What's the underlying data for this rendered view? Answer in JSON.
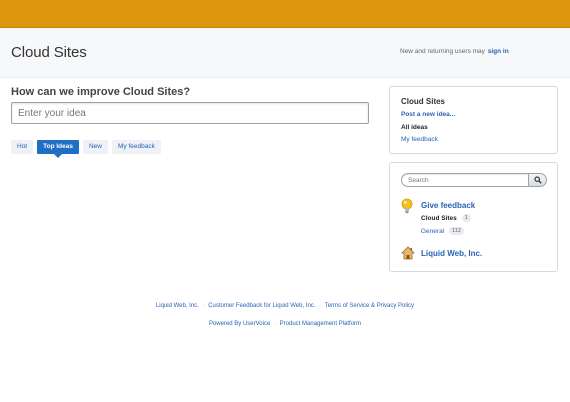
{
  "header": {
    "site_title": "Cloud Sites",
    "signin_prefix": "New and returning users may",
    "signin_link": "sign in"
  },
  "main": {
    "prompt": "How can we improve Cloud Sites?",
    "idea_placeholder": "Enter your idea",
    "tabs": [
      {
        "label": "Hot",
        "active": false
      },
      {
        "label": "Top Ideas",
        "active": true
      },
      {
        "label": "New",
        "active": false
      },
      {
        "label": "My feedback",
        "active": false
      }
    ]
  },
  "sidebar": {
    "forum_title": "Cloud Sites",
    "post_idea": "Post a new idea...",
    "all_ideas": "All ideas",
    "my_feedback": "My feedback",
    "search_placeholder": "Search",
    "give_feedback": "Give feedback",
    "forums": [
      {
        "name": "Cloud Sites",
        "count": "1",
        "current": true
      },
      {
        "name": "General",
        "count": "112",
        "current": false
      }
    ],
    "company": "Liquid Web, Inc."
  },
  "footer": {
    "line1": [
      "Liquid Web, Inc.",
      "Customer Feedback for Liquid Web, Inc.",
      "Terms of Service & Privacy Policy"
    ],
    "separator": "·",
    "line2": [
      "Powered By UserVoice",
      "Product Management Platform"
    ]
  },
  "colors": {
    "topbar": "#e0950e",
    "link": "#2a63b3",
    "active_tab": "#1f6fc5"
  }
}
